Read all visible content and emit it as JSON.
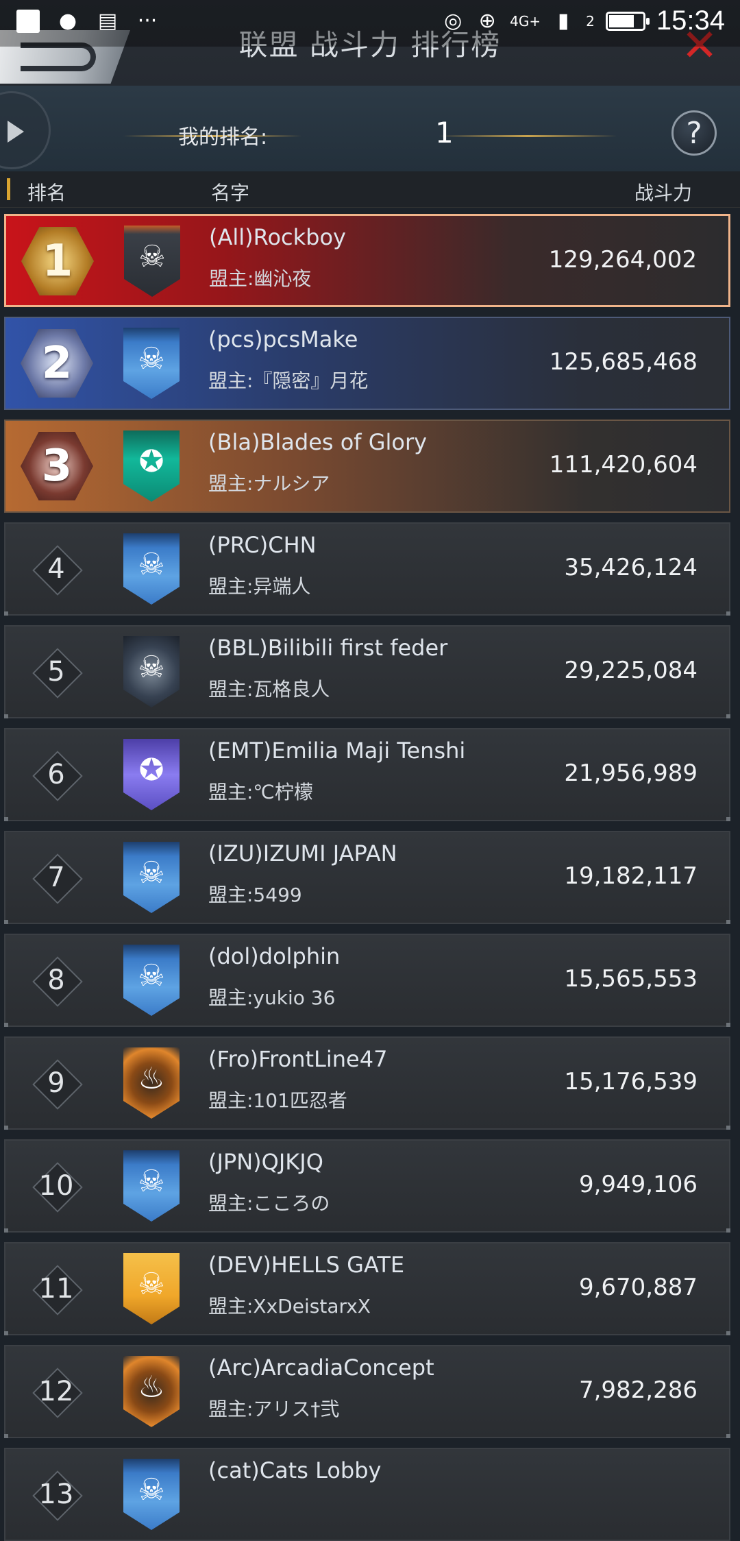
{
  "status_bar": {
    "time": "15:34",
    "network": "4G+",
    "sim_slot": "2",
    "icons": [
      "notification-square-icon",
      "qq-icon",
      "clipboard-icon",
      "more-dots-icon",
      "nfc-icon",
      "wifi-icon",
      "signal-icon",
      "battery-icon"
    ],
    "more_dots": "···",
    "battery_level": 0.7
  },
  "header": {
    "title": "联盟 战斗力 排行榜",
    "close_glyph": "✕"
  },
  "my_rank": {
    "label": "我的排名:",
    "value": "1",
    "help_glyph": "?"
  },
  "columns": {
    "rank": "排名",
    "name": "名字",
    "power": "战斗力"
  },
  "rows": [
    {
      "rank": "1",
      "name": "(All)Rockboy",
      "leader": "盟主:幽沁夜",
      "power": "129,264,002"
    },
    {
      "rank": "2",
      "name": "(pcs)pcsMake",
      "leader": "盟主:『隠密』月花",
      "power": "125,685,468"
    },
    {
      "rank": "3",
      "name": "(Bla)Blades of Glory",
      "leader": "盟主:ナルシア",
      "power": "111,420,604"
    },
    {
      "rank": "4",
      "name": "(PRC)CHN",
      "leader": "盟主:异端人",
      "power": "35,426,124"
    },
    {
      "rank": "5",
      "name": "(BBL)Bilibili first feder",
      "leader": "盟主:瓦格良人",
      "power": "29,225,084"
    },
    {
      "rank": "6",
      "name": "(EMT)Emilia Maji Tenshi",
      "leader": "盟主:℃柠檬",
      "power": "21,956,989"
    },
    {
      "rank": "7",
      "name": "(IZU)IZUMI JAPAN",
      "leader": "盟主:5499",
      "power": "19,182,117"
    },
    {
      "rank": "8",
      "name": "(dol)dolphin",
      "leader": "盟主:yukio 36",
      "power": "15,565,553"
    },
    {
      "rank": "9",
      "name": "(Fro)FrontLine47",
      "leader": "盟主:101匹忍者",
      "power": "15,176,539"
    },
    {
      "rank": "10",
      "name": "(JPN)QJKJQ",
      "leader": "盟主:こころの",
      "power": "9,949,106"
    },
    {
      "rank": "11",
      "name": "(DEV)HELLS GATE",
      "leader": "盟主:XxDeistarxX",
      "power": "9,670,887"
    },
    {
      "rank": "12",
      "name": "(Arc)ArcadiaConcept",
      "leader": "盟主:アリス†弐",
      "power": "7,982,286"
    },
    {
      "rank": "13",
      "name": "(cat)Cats Lobby",
      "leader": "",
      "power": ""
    }
  ],
  "emblem_glyphs": {
    "skull": "☠",
    "flame": "♨",
    "eagle": "✪"
  }
}
